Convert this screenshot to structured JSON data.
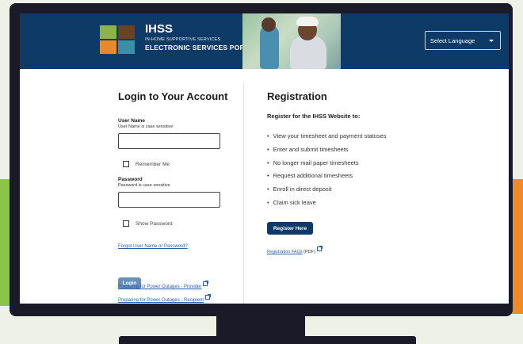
{
  "header": {
    "brand_title": "IHSS",
    "brand_subtitle": "IN-HOME SUPPORTIVE SERVICES",
    "brand_portal": "ELECTRONIC SERVICES PORTAL",
    "language_select": "Select Language"
  },
  "login": {
    "title": "Login to Your Account",
    "username_label": "User Name",
    "username_hint": "User Name is case sensitive",
    "username_value": "",
    "remember_me": "Remember Me",
    "password_label": "Password",
    "password_hint": "Password is case sensitive",
    "password_value": "",
    "show_password": "Show Password",
    "forgot_link": "Forgot User Name or Password?",
    "login_button": "Login",
    "outage_provider": "Preparing for Power Outages - Provider",
    "outage_recipient": "Preparing for Power Outages - Recipient"
  },
  "registration": {
    "title": "Registration",
    "subtitle": "Register for the IHSS Website to:",
    "items": [
      "View your timesheet and payment statuses",
      "Enter and submit timesheets",
      "No longer mail paper timesheets",
      "Request additional timesheets",
      "Enroll in direct deposit",
      "Claim sick leave"
    ],
    "register_button": "Register Here",
    "faq_link": "Registration FAQs",
    "faq_suffix": " (PDF)"
  },
  "colors": {
    "header_bg": "#0e3a68",
    "monitor": "#1b1a28",
    "link": "#2b5fb0",
    "login_button": "#6b8fb5"
  }
}
